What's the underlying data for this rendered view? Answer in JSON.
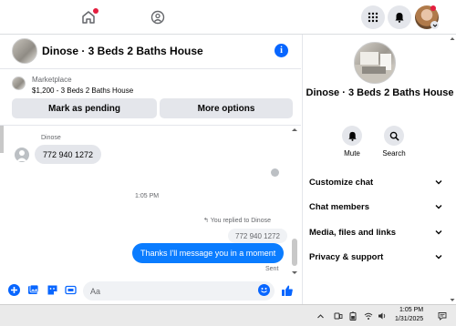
{
  "topbar": {
    "icons": [
      "home-icon",
      "marketplace-icon",
      "menu-grid-icon",
      "notifications-bell-icon",
      "profile-avatar"
    ]
  },
  "chat": {
    "title": "Dinose · 3 Beds 2 Baths House",
    "marketplace": {
      "label": "Marketplace",
      "listing": "$1,200 - 3 Beds 2 Baths House",
      "mark_pending_label": "Mark as pending",
      "more_options_label": "More options"
    },
    "messages": {
      "sender_name": "Dinose",
      "incoming_text": "772 940 1272",
      "timestamp": "1:05 PM",
      "replied_note": "You replied to Dinose",
      "quoted_text": "772 940 1272",
      "outgoing_text": "Thanks I'll message you in a moment",
      "status": "Sent"
    },
    "composer": {
      "placeholder": "Aa"
    }
  },
  "panel": {
    "title": "Dinose · 3 Beds 2 Baths House",
    "mute_label": "Mute",
    "search_label": "Search",
    "rows": [
      "Customize chat",
      "Chat members",
      "Media, files and links",
      "Privacy & support"
    ]
  },
  "taskbar": {
    "time": "1:05 PM",
    "date": "1/31/2025"
  },
  "colors": {
    "accent": "#0866ff",
    "outgoing_bubble": "#0a7cff",
    "notification_dot": "#e41e3f"
  }
}
